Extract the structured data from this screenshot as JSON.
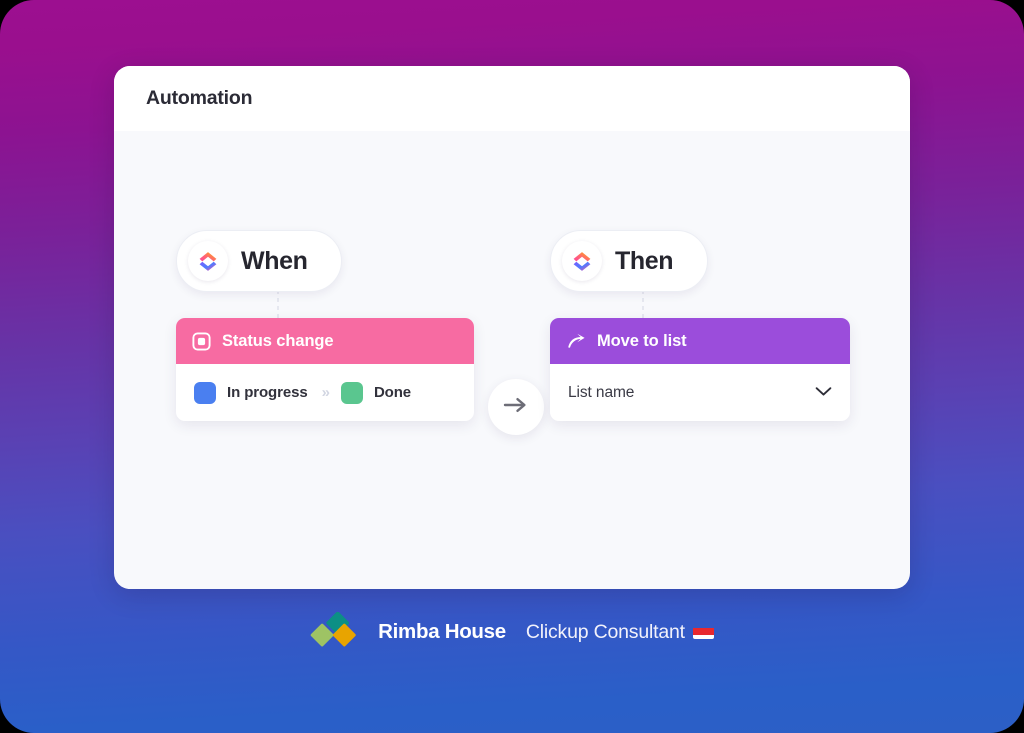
{
  "background": {
    "gradient_top": "#9c0f90",
    "gradient_mid": "#5a41b3",
    "gradient_bottom": "#2a5fc8"
  },
  "panel": {
    "title": "Automation",
    "surface_color": "#f8f9fc",
    "header_color": "#ffffff"
  },
  "flow": {
    "when": {
      "pill_label": "When",
      "pill_icon": "clickup-logo-icon",
      "card": {
        "header_label": "Status change",
        "header_icon": "status-square-icon",
        "header_color": "#f76ba2",
        "from_status": {
          "label": "In progress",
          "color": "#4a7ff0"
        },
        "separator_icon": "double-chevron-right-icon",
        "to_status": {
          "label": "Done",
          "color": "#5ac68f"
        }
      }
    },
    "connector_arrow_icon": "arrow-right-icon",
    "then": {
      "pill_label": "Then",
      "pill_icon": "clickup-logo-icon",
      "card": {
        "header_label": "Move to list",
        "header_icon": "move-arrow-icon",
        "header_color": "#9b4ddb",
        "select_value": "List name",
        "select_caret_icon": "chevron-down-icon"
      }
    }
  },
  "brand": {
    "logo_icon": "rimba-house-diamonds-icon",
    "logo_colors": {
      "teal": "#0c8f85",
      "green": "#9ec364",
      "gold": "#e8a400"
    },
    "name": "Rimba House",
    "tagline": "Clickup Consultant",
    "flag_icon": "indonesia-flag-icon",
    "flag_colors": {
      "top": "#e8282f",
      "bottom": "#ffffff"
    }
  }
}
